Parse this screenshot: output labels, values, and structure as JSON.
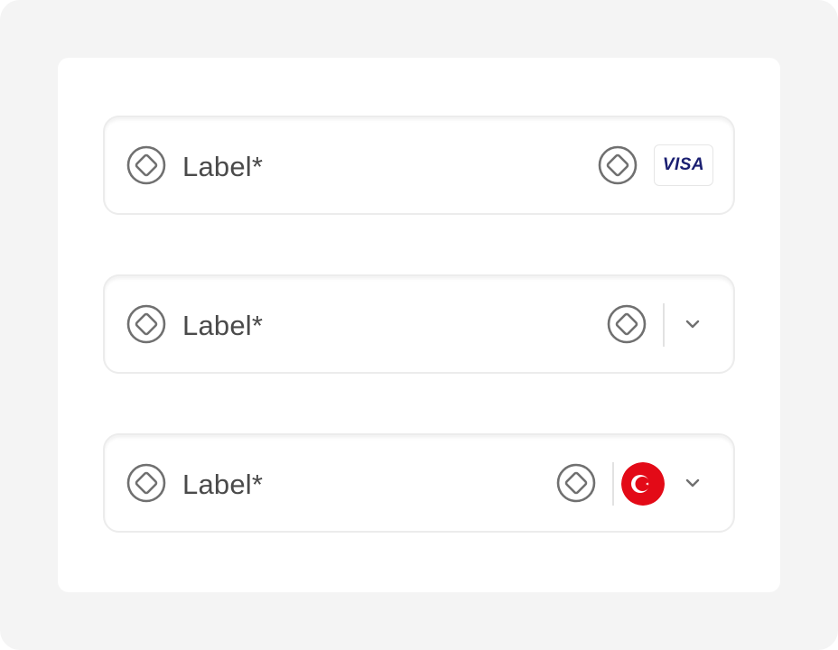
{
  "fields": [
    {
      "label": "Label*",
      "leading_icon": "diamond-icon",
      "trailing_icon": "diamond-icon",
      "card_brand": "VISA"
    },
    {
      "label": "Label*",
      "leading_icon": "diamond-icon",
      "trailing_icon": "diamond-icon",
      "dropdown_icon": "chevron-down-icon"
    },
    {
      "label": "Label*",
      "leading_icon": "diamond-icon",
      "trailing_icon": "diamond-icon",
      "country_flag": "turkey-flag-icon",
      "dropdown_icon": "chevron-down-icon"
    }
  ],
  "colors": {
    "background": "#f4f4f4",
    "card": "#ffffff",
    "field_border": "#ececec",
    "label_text": "#4a4a4a",
    "icon_stroke": "#707070",
    "visa_blue": "#1a1f71",
    "flag_red": "#e30a17"
  }
}
